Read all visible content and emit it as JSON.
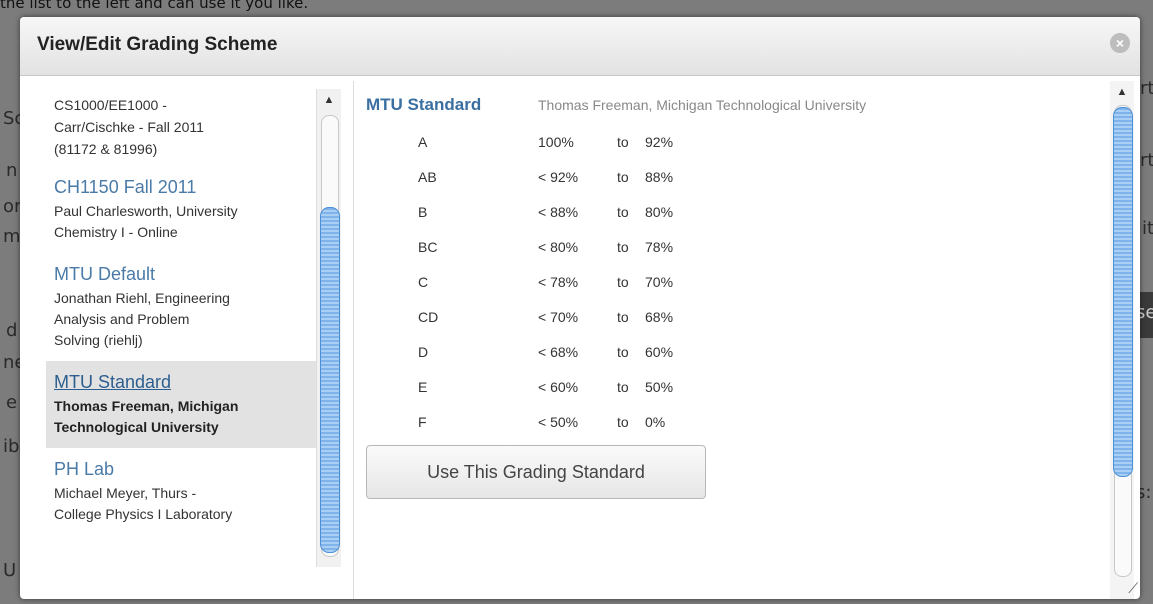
{
  "background": {
    "top_text": "the list to the left and can use it you like.",
    "fragments": [
      "Sc",
      "n",
      "or",
      "m",
      "d",
      "ne",
      "e",
      "ib",
      "U",
      "rt",
      "rt",
      "it",
      "se",
      "s:"
    ]
  },
  "dialog": {
    "title": "View/Edit Grading Scheme",
    "close_glyph": "×"
  },
  "scheme_list": {
    "first_partial_desc_lines": [
      "CS1000/EE1000 -",
      "Carr/Cischke - Fall 2011",
      "(81172 & 81996)"
    ],
    "items": [
      {
        "name": "CH1150 Fall 2011",
        "desc": [
          "Paul Charlesworth, University",
          "Chemistry I - Online"
        ],
        "selected": false
      },
      {
        "name": "MTU Default",
        "desc": [
          "Jonathan Riehl, Engineering",
          "Analysis and Problem",
          "Solving (riehlj)"
        ],
        "selected": false
      },
      {
        "name": "MTU Standard",
        "desc": [
          "Thomas Freeman, Michigan",
          "Technological University"
        ],
        "selected": true
      },
      {
        "name": "PH Lab",
        "desc": [
          "Michael Meyer, Thurs -",
          "College Physics I Laboratory"
        ],
        "selected": false
      }
    ]
  },
  "detail": {
    "title": "MTU Standard",
    "subtitle": "Thomas Freeman, Michigan Technological University",
    "to_label": "to",
    "rows": [
      {
        "grade": "A",
        "max": "100%",
        "min": "92%"
      },
      {
        "grade": "AB",
        "max": "< 92%",
        "min": "88%"
      },
      {
        "grade": "B",
        "max": "< 88%",
        "min": "80%"
      },
      {
        "grade": "BC",
        "max": "< 80%",
        "min": "78%"
      },
      {
        "grade": "C",
        "max": "< 78%",
        "min": "70%"
      },
      {
        "grade": "CD",
        "max": "< 70%",
        "min": "68%"
      },
      {
        "grade": "D",
        "max": "< 68%",
        "min": "60%"
      },
      {
        "grade": "E",
        "max": "< 60%",
        "min": "50%"
      },
      {
        "grade": "F",
        "max": "< 50%",
        "min": "0%"
      }
    ],
    "use_button_label": "Use This Grading Standard"
  },
  "icons": {
    "close": "close-icon",
    "scroll_up": "scroll-up-arrow-icon",
    "resize": "resize-grip-icon"
  }
}
